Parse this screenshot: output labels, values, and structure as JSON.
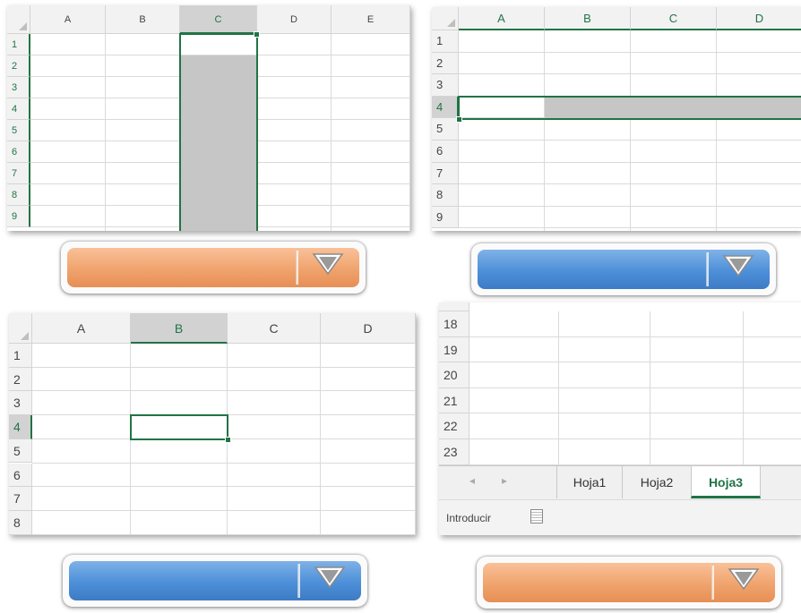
{
  "panel1": {
    "columns": [
      "A",
      "B",
      "C",
      "D",
      "E"
    ],
    "rows": [
      "1",
      "2",
      "3",
      "4",
      "5",
      "6",
      "7",
      "8",
      "9"
    ],
    "selected_column": "C"
  },
  "panel2": {
    "columns": [
      "A",
      "B",
      "C",
      "D"
    ],
    "rows": [
      "1",
      "2",
      "3",
      "4",
      "5",
      "6",
      "7",
      "8",
      "9"
    ],
    "selected_row": "4"
  },
  "panel3": {
    "columns": [
      "A",
      "B",
      "C",
      "D"
    ],
    "rows": [
      "1",
      "2",
      "3",
      "4",
      "5",
      "6",
      "7",
      "8"
    ],
    "selected_cell": "B4"
  },
  "panel4": {
    "rows": [
      "18",
      "19",
      "20",
      "21",
      "22",
      "23"
    ],
    "nav": {
      "prev": "◂",
      "next": "▸"
    },
    "sheets": [
      "Hoja1",
      "Hoja2",
      "Hoja3"
    ],
    "active_sheet": "Hoja3",
    "status_mode": "Introducir"
  },
  "dropdowns": [
    {
      "id": "top-left",
      "color": "orange"
    },
    {
      "id": "top-right",
      "color": "blue"
    },
    {
      "id": "bottom-left",
      "color": "blue"
    },
    {
      "id": "bottom-right",
      "color": "orange"
    }
  ],
  "colors": {
    "excel_green": "#217346",
    "orange": "#f0a36d",
    "blue": "#4d8fd8",
    "selection_shade": "#c6c6c6"
  }
}
